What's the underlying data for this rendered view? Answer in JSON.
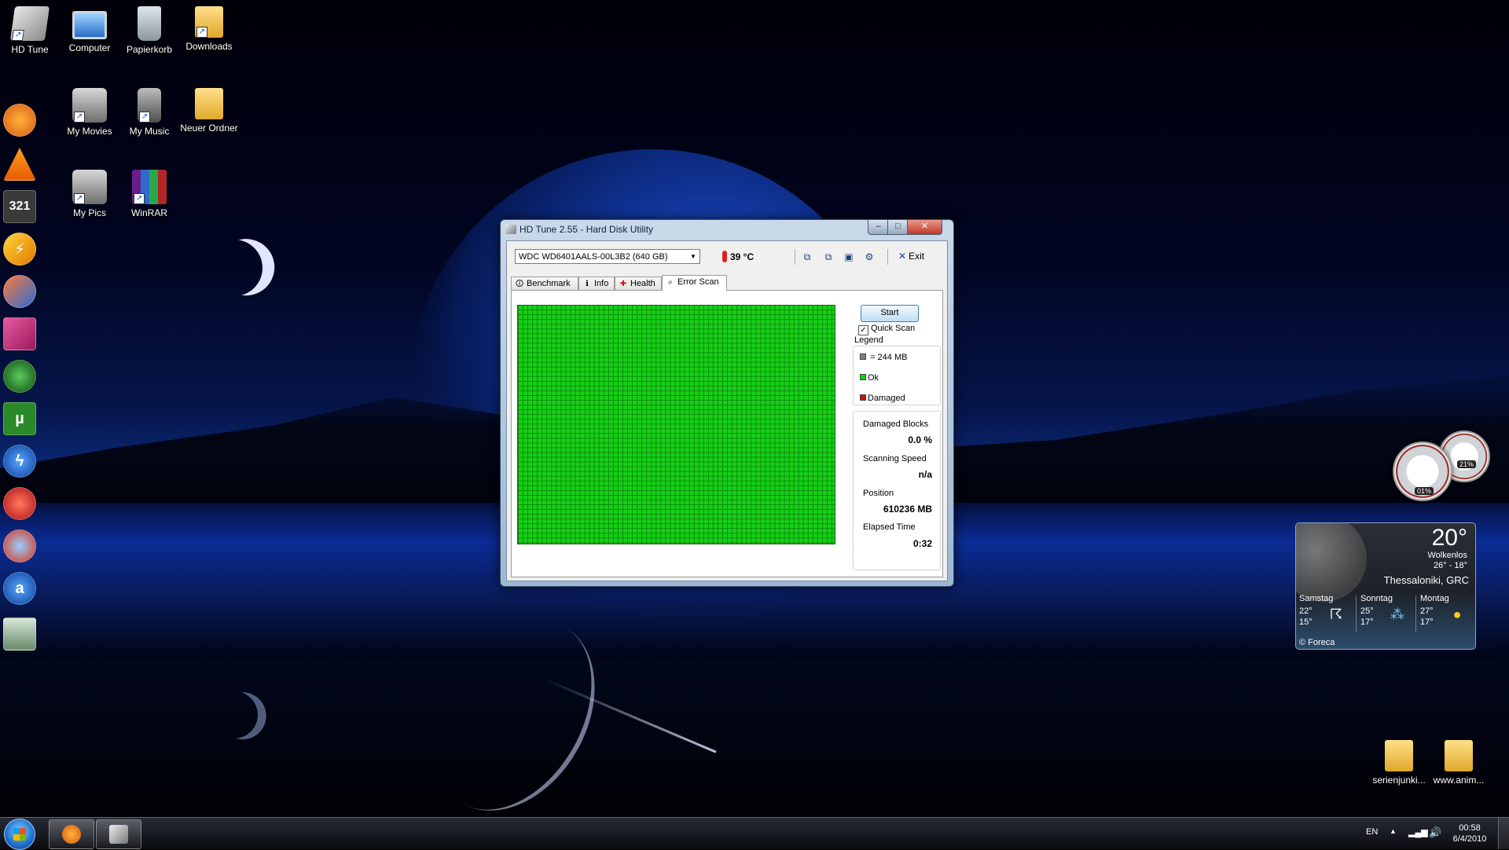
{
  "desktop": {
    "icons": [
      {
        "label": "HD Tune",
        "icon": "hd-tune-icon"
      },
      {
        "label": "Computer",
        "icon": "computer-icon"
      },
      {
        "label": "Papierkorb",
        "icon": "recycle-bin-icon"
      },
      {
        "label": "Downloads",
        "icon": "folder-icon"
      },
      {
        "label": "My Movies",
        "icon": "camcorder-icon"
      },
      {
        "label": "My Music",
        "icon": "music-player-icon"
      },
      {
        "label": "Neuer Ordner",
        "icon": "folder-icon"
      },
      {
        "label": "My Pics",
        "icon": "camera-icon"
      },
      {
        "label": "WinRAR",
        "icon": "winrar-icon"
      },
      {
        "label": "serienjunki...",
        "icon": "folder-icon"
      },
      {
        "label": "www.anim...",
        "icon": "folder-icon"
      }
    ],
    "dock": [
      "firefox-icon",
      "vlc-icon",
      "media-player-icon",
      "winamp-icon",
      "tool-icon",
      "pen-icon",
      "globe-icon",
      "utorrent-icon",
      "lightning-icon",
      "burner-icon",
      "browser-icon",
      "amazon-icon",
      "layers-icon"
    ]
  },
  "window": {
    "title": "HD Tune 2.55 - Hard Disk Utility",
    "drive": "WDC WD6401AALS-00L3B2 (640 GB)",
    "temperature": "39 °C",
    "exit_label": "Exit",
    "tabs": [
      {
        "label": "Benchmark",
        "icon": "benchmark-icon",
        "active": false
      },
      {
        "label": "Info",
        "icon": "info-icon",
        "active": false
      },
      {
        "label": "Health",
        "icon": "health-icon",
        "active": false
      },
      {
        "label": "Error Scan",
        "icon": "magnifier-icon",
        "active": true
      }
    ],
    "start_label": "Start",
    "quick_scan_label": "Quick Scan",
    "quick_scan_checked": true,
    "legend_title": "Legend",
    "legend": [
      {
        "label": "= 244 MB",
        "color": "#808080"
      },
      {
        "label": "Ok",
        "color": "#16d016"
      },
      {
        "label": "Damaged",
        "color": "#cc1111"
      }
    ],
    "stats": {
      "damaged_blocks_label": "Damaged Blocks",
      "damaged_blocks_value": "0.0 %",
      "scanning_speed_label": "Scanning Speed",
      "scanning_speed_value": "n/a",
      "position_label": "Position",
      "position_value": "610236 MB",
      "elapsed_time_label": "Elapsed Time",
      "elapsed_time_value": "0:32"
    },
    "scan_block_color": "#16d016"
  },
  "gauges": {
    "cpu_value": "01%",
    "memory_value": "21%"
  },
  "weather": {
    "temperature": "20°",
    "condition": "Wolkenlos",
    "range": "26° - 18°",
    "city": "Thessaloniki, GRC",
    "days": [
      {
        "name": "Samstag",
        "high": "22°",
        "low": "15°",
        "icon": "thunderstorm-icon"
      },
      {
        "name": "Sonntag",
        "high": "25°",
        "low": "17°",
        "icon": "rain-icon"
      },
      {
        "name": "Montag",
        "high": "27°",
        "low": "17°",
        "icon": "sun-icon"
      }
    ],
    "footer": "© Foreca"
  },
  "taskbar": {
    "language": "EN",
    "time": "00:58",
    "date": "6/4/2010"
  }
}
